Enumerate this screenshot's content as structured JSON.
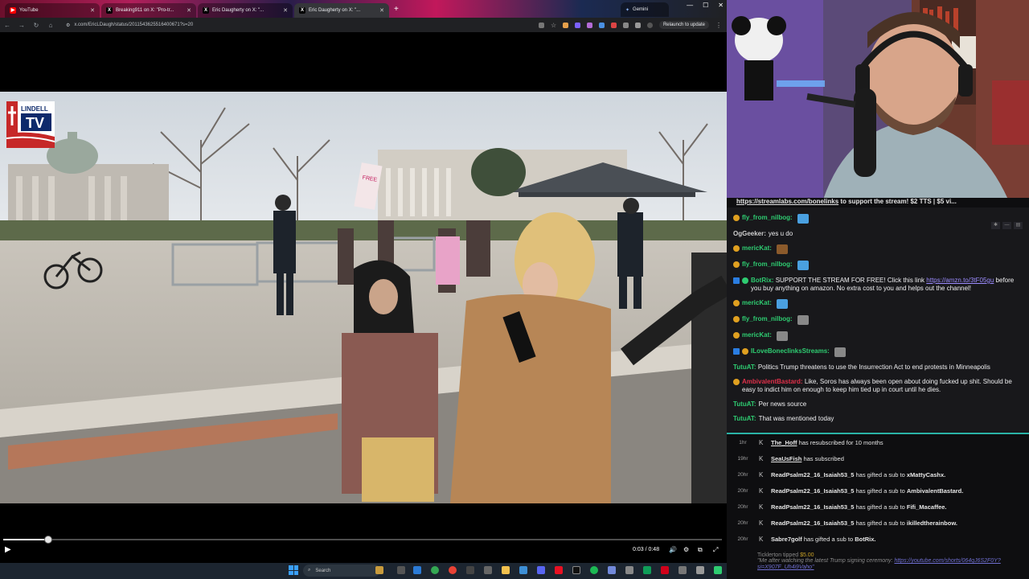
{
  "browser": {
    "tabs": [
      {
        "label": "YouTube",
        "favicon": "youtube-icon"
      },
      {
        "label": "Breaking911 on X: \"Pro-tr...",
        "favicon": "x-icon"
      },
      {
        "label": "Eric Daugherty on X: \"...",
        "favicon": "x-icon"
      },
      {
        "label": "Eric Daugherty on X: \"...",
        "favicon": "x-icon"
      }
    ],
    "new_tab": "+",
    "gemini_label": "Gemini",
    "url": "x.com/EricLDaugh/status/2011543625516400671?s=20",
    "relaunch_label": "Relaunch to update"
  },
  "video": {
    "logo_line1": "LINDELL",
    "logo_line2": "TV",
    "sign_text": "FREE PALESTINE ... ISRAEL",
    "time_display": "0:03 / 0:48",
    "progress_fraction": 0.0625
  },
  "taskbar": {
    "search_placeholder": "Search"
  },
  "chat": {
    "ticker_link": "https://streamlabs.com/bonelinks",
    "ticker_text": " to support the stream! $2 TTS | $5 vi...",
    "messages": [
      {
        "user": "fly_from_nilbog:",
        "color": "#2ecc71",
        "badge": "#e0a020",
        "text": "",
        "emote": "#4aa0e0"
      },
      {
        "user": "OgGeeker:",
        "color": "#cfcfcf",
        "badge": "",
        "text": "yes u do",
        "emote": ""
      },
      {
        "user": "mericKat:",
        "color": "#2ecc71",
        "badge": "#e0a020",
        "text": "",
        "emote": "#8b5a2b"
      },
      {
        "user": "fly_from_nilbog:",
        "color": "#2ecc71",
        "badge": "#e0a020",
        "text": "",
        "emote": "#4aa0e0"
      },
      {
        "user": "BotRix:",
        "color": "#2ecc71",
        "badge": "#2a7de1",
        "text": "SUPPORT THE STREAM FOR FREE! Click this link ",
        "link": "https://amzn.to/3tF05gu",
        "text2": " before you buy anything on amazon. No extra cost to you and helps out the channel!",
        "emote": ""
      },
      {
        "user": "mericKat:",
        "color": "#2ecc71",
        "badge": "#e0a020",
        "text": "",
        "emote": "#4aa0e0"
      },
      {
        "user": "fly_from_nilbog:",
        "color": "#2ecc71",
        "badge": "#e0a020",
        "text": "",
        "emote": "#888888"
      },
      {
        "user": "mericKat:",
        "color": "#2ecc71",
        "badge": "#e0a020",
        "text": "",
        "emote": "#888888"
      },
      {
        "user": "ILoveBonecIinksStreams:",
        "color": "#2ecc71",
        "badge": "#2a7de1",
        "text": "",
        "emote": "#888888"
      },
      {
        "user": "TutuAT:",
        "color": "#2ecc71",
        "badge": "",
        "text": "Politics Trump threatens to use the Insurrection Act to end protests in Minneapolis",
        "emote": ""
      },
      {
        "user": "AmbivalentBastard:",
        "color": "#e0304a",
        "badge": "#e0a020",
        "text": "Like, Soros has always been open about doing fucked up shit. Should be easy to indict him on enough to keep him tied up in court until he dies.",
        "emote": ""
      },
      {
        "user": "TutuAT:",
        "color": "#2ecc71",
        "badge": "",
        "text": "Per news source",
        "emote": ""
      },
      {
        "user": "TutuAT:",
        "color": "#2ecc71",
        "badge": "",
        "text": "That was mentioned today",
        "emote": ""
      }
    ]
  },
  "events": [
    {
      "time": "1hr",
      "user": "The_Hoff",
      "text": " has resubscribed for 10 months",
      "target": ""
    },
    {
      "time": "19hr",
      "user": "SeaUsFish",
      "text": " has subscribed",
      "target": ""
    },
    {
      "time": "20hr",
      "user": "ReadPsalm22_16_Isaiah53_5",
      "text": " has gifted a sub to ",
      "target": "xMattyCashx."
    },
    {
      "time": "20hr",
      "user": "ReadPsalm22_16_Isaiah53_5",
      "text": " has gifted a sub to ",
      "target": "AmbivalentBastard."
    },
    {
      "time": "20hr",
      "user": "ReadPsalm22_16_Isaiah53_5",
      "text": " has gifted a sub to ",
      "target": "Fifi_Macaffee."
    },
    {
      "time": "20hr",
      "user": "ReadPsalm22_16_Isaiah53_5",
      "text": " has gifted a sub to ",
      "target": "ikilledtherainbow."
    },
    {
      "time": "20hr",
      "user": "Sabre7golf",
      "text": " has gifted a sub to ",
      "target": "BotRix."
    }
  ],
  "tip": {
    "user": "Ticklerton",
    "text": " tipped ",
    "amount": "$5.00",
    "message": "\"Me after watching the latest Trump signing ceremony: ",
    "link": "https://youtube.com/shorts/064qJ6S2F0Y?si=X907F_Uh4i9Vaho\""
  }
}
